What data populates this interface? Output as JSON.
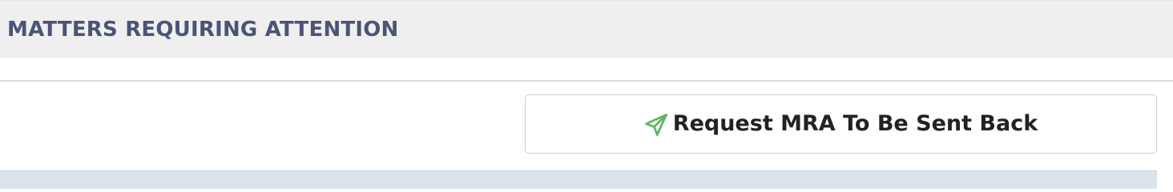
{
  "section": {
    "title": "MATTERS REQUIRING ATTENTION"
  },
  "actions": {
    "request_button": {
      "label": "Request MRA To Be Sent Back",
      "icon": "paper-plane-icon",
      "icon_color": "#5cb85c"
    }
  },
  "colors": {
    "header_text": "#4a5477",
    "header_bg": "#efefef",
    "panel_bg": "#dde3ea"
  }
}
